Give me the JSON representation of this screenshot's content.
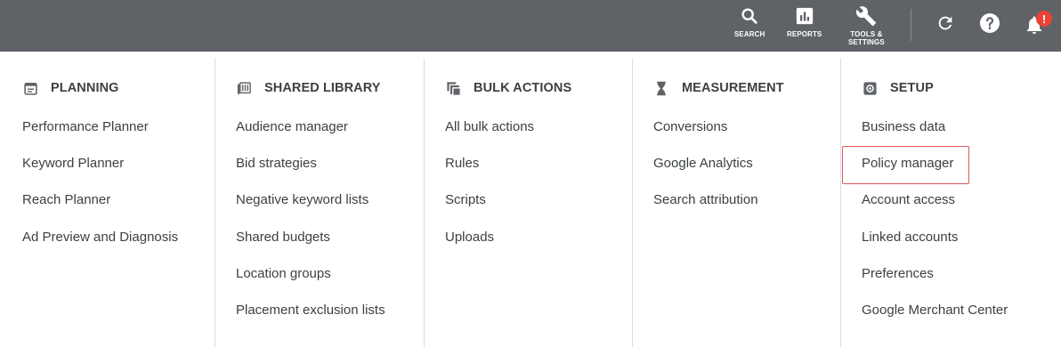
{
  "toolbar": {
    "search_label": "SEARCH",
    "reports_label": "REPORTS",
    "tools_label_line1": "TOOLS &",
    "tools_label_line2": "SETTINGS",
    "notification_badge": "!"
  },
  "columns": [
    {
      "heading": "PLANNING",
      "icon": "calendar-icon",
      "items": [
        "Performance Planner",
        "Keyword Planner",
        "Reach Planner",
        "Ad Preview and Diagnosis"
      ]
    },
    {
      "heading": "SHARED LIBRARY",
      "icon": "library-icon",
      "items": [
        "Audience manager",
        "Bid strategies",
        "Negative keyword lists",
        "Shared budgets",
        "Location groups",
        "Placement exclusion lists"
      ]
    },
    {
      "heading": "BULK ACTIONS",
      "icon": "copy-stack-icon",
      "items": [
        "All bulk actions",
        "Rules",
        "Scripts",
        "Uploads"
      ]
    },
    {
      "heading": "MEASUREMENT",
      "icon": "hourglass-icon",
      "items": [
        "Conversions",
        "Google Analytics",
        "Search attribution"
      ]
    },
    {
      "heading": "SETUP",
      "icon": "settings-box-icon",
      "items": [
        "Business data",
        "Policy manager",
        "Account access",
        "Linked accounts",
        "Preferences",
        "Google Merchant Center"
      ]
    }
  ],
  "colors": {
    "topbar": "#5f6368",
    "text": "#3c4043",
    "divider": "#dadce0",
    "highlight_border": "#d9595a",
    "badge": "#ea4335"
  }
}
